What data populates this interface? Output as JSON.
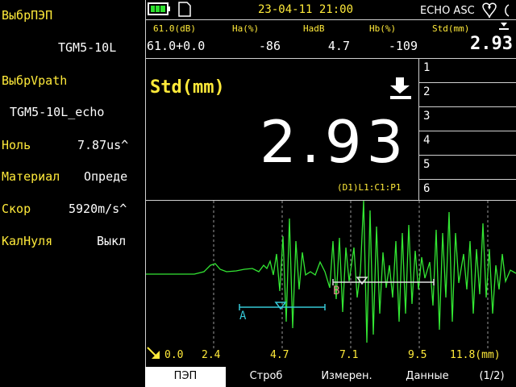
{
  "left_panel": {
    "items": [
      {
        "label": "ВыбрПЭП",
        "value": "TGM5-10L"
      },
      {
        "label": "ВыбрVpath",
        "value": "TGM5-10L_echo"
      },
      {
        "label": "Ноль",
        "value": "7.87us^"
      },
      {
        "label": "Материал",
        "value": "Опреде"
      },
      {
        "label": "Скор",
        "value": "5920m/s^"
      },
      {
        "label": "КалНуля",
        "value": "Выкл"
      }
    ]
  },
  "status": {
    "datetime": "23-04-11 21:00",
    "mode": "ECHO ASC",
    "battery_icon": "battery-icon",
    "sd_icon": "sd-card-icon"
  },
  "readings": {
    "headers": [
      "61.0(dB)",
      "Ha(%)",
      "HadB",
      "Hb(%)",
      "Std(mm)"
    ],
    "values": [
      "61.0+0.0",
      "-86",
      "4.7",
      "-109",
      "2.93"
    ]
  },
  "measurement": {
    "label": "Std(mm)",
    "value": "2.93",
    "ref": "(D1)L1:C1:P1",
    "slots": [
      "1",
      "2",
      "3",
      "4",
      "5",
      "6"
    ]
  },
  "waveform": {
    "gate_a_label": "A",
    "gate_b_label": "B",
    "gate_a_color": "#35c7d6",
    "gate_b_color": "#e0e0e0",
    "trace_color": "#33e633",
    "gate_b_label_color": "#d98a8a"
  },
  "scale": {
    "ticks": [
      "0.0",
      "2.4",
      "4.7",
      "7.1",
      "9.5",
      "11.8(mm)"
    ]
  },
  "softkeys": [
    "ПЭП",
    "Строб",
    "Измерен.",
    "Данные",
    "(1/2)"
  ]
}
